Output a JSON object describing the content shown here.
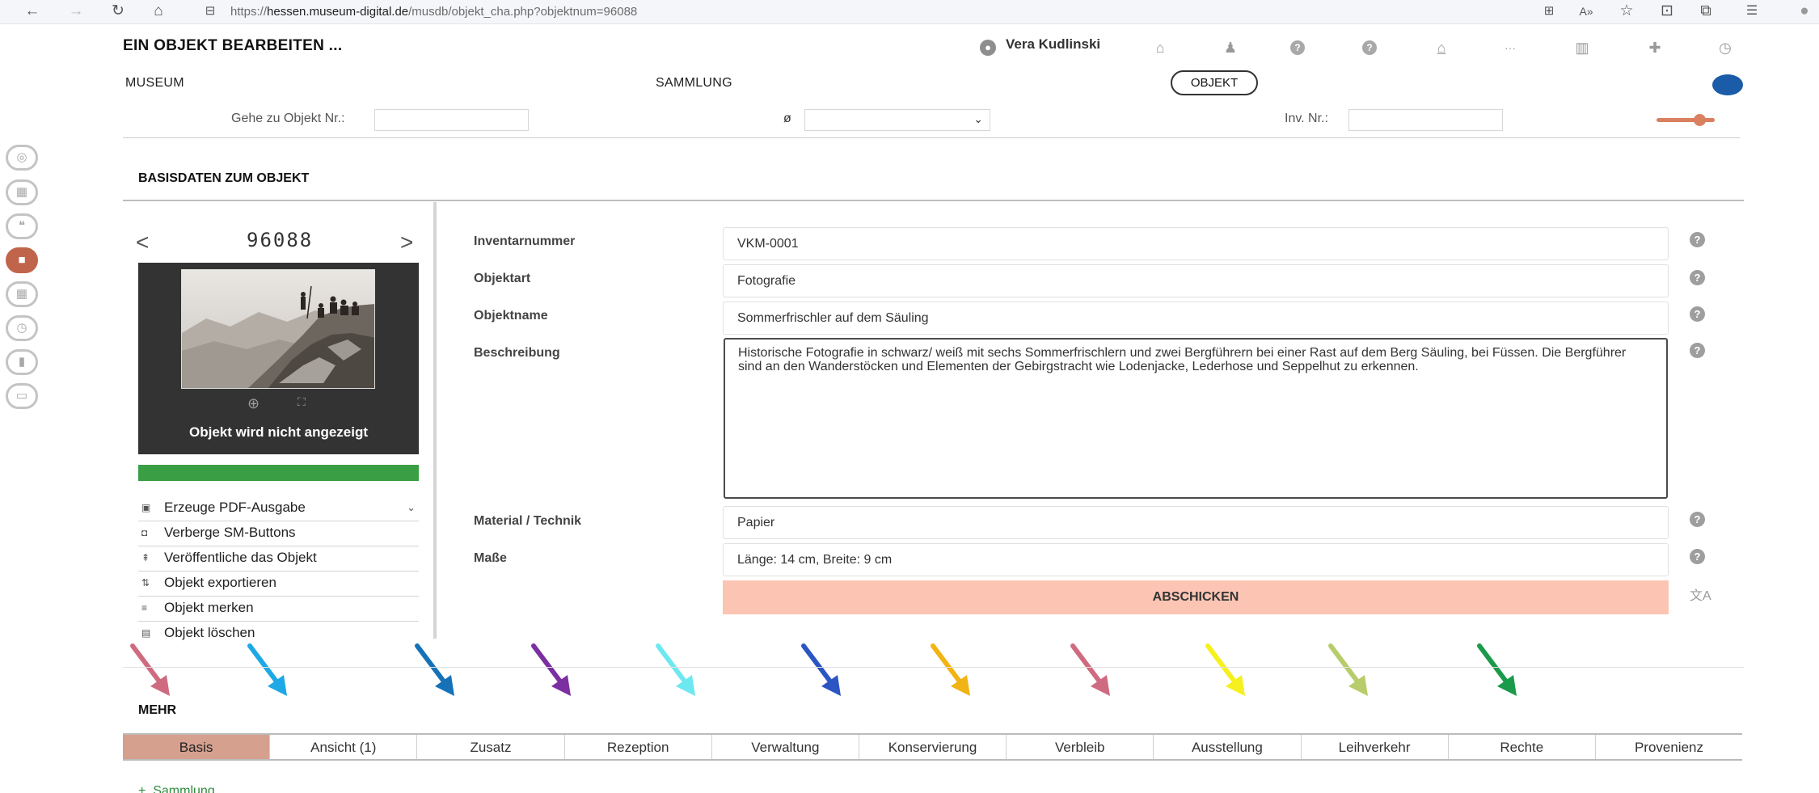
{
  "browser": {
    "url_prefix": "https://",
    "url_host": "hessen.museum-digital.de",
    "url_path": "/musdb/objekt_cha.php?objektnum=96088",
    "icons": [
      "back-icon",
      "forward-icon",
      "reload-icon",
      "home-icon",
      "site-info-icon",
      "app-grid-icon",
      "read-aloud-icon",
      "favorite-icon",
      "collections-icon",
      "extensions-icon",
      "favorites-bar-icon",
      "profile-icon"
    ],
    "icon_glyphs": {
      "back": "←",
      "forward": "→",
      "reload": "↻",
      "home": "⌂",
      "site": "⊟",
      "grid": "⊞",
      "read": "A»",
      "fav": "☆",
      "coll": "⊡",
      "ext": "⧉",
      "favbar": "☰",
      "profile": "●"
    }
  },
  "header": {
    "title": "EIN OBJEKT BEARBEITEN ...",
    "user_icon_glyph": "●",
    "user_name": "Vera Kudlinski",
    "icons": [
      {
        "name": "home-icon",
        "glyph": "⌂"
      },
      {
        "name": "bell-icon",
        "glyph": "♟"
      },
      {
        "name": "help-icon",
        "glyph": "?"
      },
      {
        "name": "help-alt-icon",
        "glyph": "?"
      },
      {
        "name": "museum-icon",
        "glyph": "⌂"
      },
      {
        "name": "more-icon",
        "glyph": "···"
      },
      {
        "name": "statistics-icon",
        "glyph": "▥"
      },
      {
        "name": "puzzle-icon",
        "glyph": "✚"
      },
      {
        "name": "clock-icon",
        "glyph": "◷"
      }
    ],
    "nav": {
      "museum": "MUSEUM",
      "sammlung": "SAMMLUNG",
      "objekt": "OBJEKT"
    }
  },
  "goto": {
    "objekt_label": "Gehe zu Objekt Nr.:",
    "objekt_value": "",
    "select_symbol": "ø",
    "select_value": "",
    "inv_label": "Inv. Nr.:",
    "inv_value": ""
  },
  "sidebar": {
    "icons": [
      {
        "name": "globe-icon",
        "glyph": "◎"
      },
      {
        "name": "qr-code-icon",
        "glyph": "▦"
      },
      {
        "name": "comments-icon",
        "glyph": "❝"
      },
      {
        "name": "comment-icon",
        "glyph": "■"
      },
      {
        "name": "qr-code-alt-icon",
        "glyph": "▦"
      },
      {
        "name": "history-icon",
        "glyph": "◷"
      },
      {
        "name": "bookmark-icon",
        "glyph": "▮"
      },
      {
        "name": "id-card-icon",
        "glyph": "▭"
      }
    ],
    "active_index": 3
  },
  "section": {
    "title": "BASISDATEN ZUM OBJEKT"
  },
  "object": {
    "prev": "<",
    "next": ">",
    "number": "96088",
    "zoom_glyph": "⊕",
    "fullscreen_glyph": "⛶",
    "caption": "Objekt wird nicht angezeigt"
  },
  "actions": [
    {
      "label": "Erzeuge PDF-Ausgabe",
      "icon": "pdf-icon",
      "glyph": "▣"
    },
    {
      "label": "Verberge SM-Buttons",
      "icon": "hide-social-icon",
      "glyph": "◘"
    },
    {
      "label": "Veröffentliche das Objekt",
      "icon": "publish-icon",
      "glyph": "⇞"
    },
    {
      "label": "Objekt exportieren",
      "icon": "export-icon",
      "glyph": "⇅"
    },
    {
      "label": "Objekt merken",
      "icon": "bookmark-add-icon",
      "glyph": "≡"
    },
    {
      "label": "Objekt löschen",
      "icon": "trash-icon",
      "glyph": "▤"
    }
  ],
  "form": {
    "inventarnummer": {
      "label": "Inventarnummer",
      "value": "VKM-0001"
    },
    "objektart": {
      "label": "Objektart",
      "value": "Fotografie"
    },
    "objektname": {
      "label": "Objektname",
      "value": "Sommerfrischler auf dem Säuling"
    },
    "beschreibung": {
      "label": "Beschreibung",
      "value": "Historische Fotografie in schwarz/ weiß mit sechs Sommerfrischlern und zwei Bergführern bei einer Rast auf dem Berg Säuling, bei Füssen. Die Bergführer sind an den Wanderstöcken und Elementen der Gebirgstracht wie Lodenjacke, Lederhose und Seppelhut zu erkennen."
    },
    "material": {
      "label": "Material / Technik",
      "value": "Papier"
    },
    "masse": {
      "label": "Maße",
      "value": "Länge: 14 cm, Breite: 9 cm"
    },
    "submit": "ABSCHICKEN",
    "help_glyph": "?",
    "translate_glyph": "文A"
  },
  "mehr": {
    "title": "MEHR",
    "tabs": [
      "Basis",
      "Ansicht (1)",
      "Zusatz",
      "Rezeption",
      "Verwaltung",
      "Konservierung",
      "Verbleib",
      "Ausstellung",
      "Leihverkehr",
      "Rechte",
      "Provenienz"
    ],
    "active_tab": "Basis",
    "arrow_colors": [
      "#cf6b80",
      "#1ea8e6",
      "#1572b8",
      "#7b2fa0",
      "#6ee8f0",
      "#2c55c4",
      "#f2b315",
      "#cf6b80",
      "#f5f01e",
      "#b7cc6a",
      "#1a9a4a"
    ]
  },
  "sammlung": {
    "glyph": "+",
    "label": "Sammlung"
  }
}
